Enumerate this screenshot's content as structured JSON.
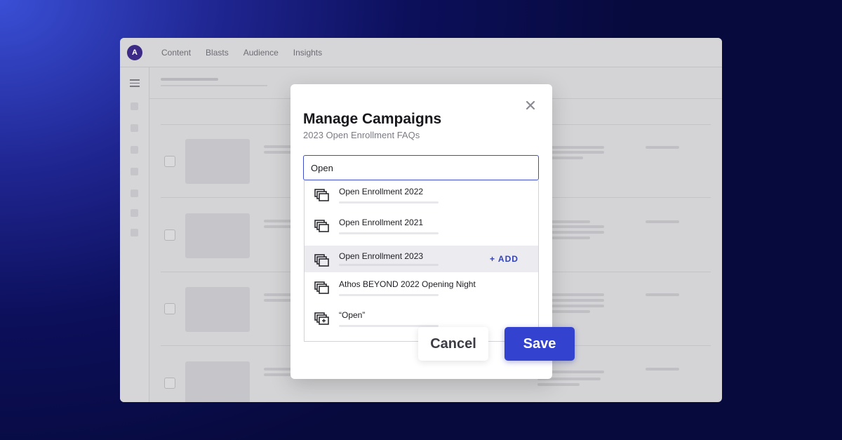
{
  "app": {
    "logo_letter": "A",
    "nav": [
      "Content",
      "Blasts",
      "Audience",
      "Insights"
    ]
  },
  "modal": {
    "title": "Manage Campaigns",
    "subtitle": "2023 Open Enrollment FAQs",
    "close_icon": "close-icon",
    "search": {
      "value": "Open"
    },
    "results": [
      {
        "label": "Open Enrollment 2022",
        "icon": "campaign-stack-icon"
      },
      {
        "label": "Open Enrollment 2021",
        "icon": "campaign-stack-icon"
      },
      {
        "label": "Open Enrollment 2023",
        "icon": "campaign-stack-icon",
        "highlighted": true,
        "action": "+ ADD"
      },
      {
        "label": "Athos BEYOND 2022 Opening Night",
        "icon": "campaign-stack-icon"
      },
      {
        "label": "“Open”",
        "icon": "campaign-create-icon"
      }
    ]
  },
  "actions": {
    "cancel_label": "Cancel",
    "save_label": "Save"
  },
  "colors": {
    "accent": "#3343cf",
    "background": "#0c0f5a",
    "logo": "#3d2a86"
  }
}
